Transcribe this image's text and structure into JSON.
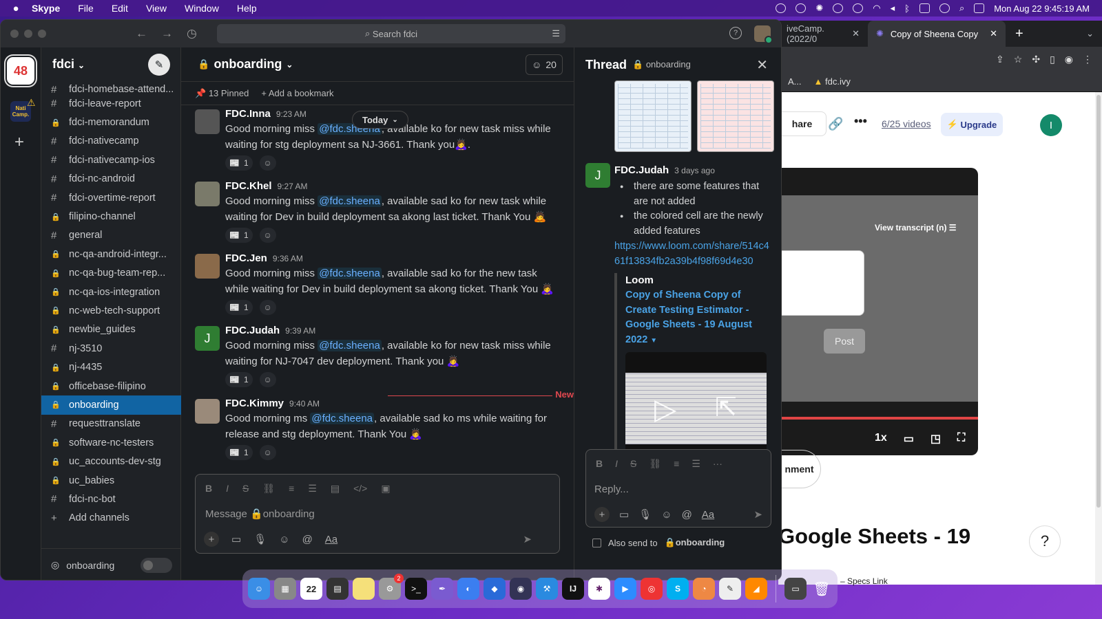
{
  "menubar": {
    "app_name": "Skype",
    "items": [
      "File",
      "Edit",
      "View",
      "Window",
      "Help"
    ],
    "datetime": "Mon Aug 22  9:45:19 AM"
  },
  "chrome": {
    "tabs": [
      {
        "label": "iveCamp. (2022/0",
        "active": false
      },
      {
        "label": "Copy of Sheena Copy",
        "active": true
      }
    ],
    "bookmarks": [
      "A...",
      "fdc.ivy"
    ],
    "page": {
      "share_label": "hare",
      "videos_label": "6/25 videos",
      "upgrade_label": "Upgrade",
      "avatar_initial": "I",
      "transcript_label": "View transcript (n)",
      "post_label": "Post",
      "speed_label": "1x",
      "comment_label": "nment",
      "heading": "Google Sheets - 19",
      "help_label": "?",
      "below_text": "– Specs Link"
    }
  },
  "slack": {
    "search_placeholder": "Search fdci",
    "workspace": {
      "name": "fdci",
      "logo_text": "48",
      "second_ws_text": "Nati Camp."
    },
    "channels": [
      {
        "sym": "#",
        "name": "fdci-homebase-attend..."
      },
      {
        "sym": "#",
        "name": "fdci-leave-report"
      },
      {
        "sym": "🔒",
        "name": "fdci-memorandum"
      },
      {
        "sym": "#",
        "name": "fdci-nativecamp"
      },
      {
        "sym": "#",
        "name": "fdci-nativecamp-ios"
      },
      {
        "sym": "#",
        "name": "fdci-nc-android"
      },
      {
        "sym": "#",
        "name": "fdci-overtime-report"
      },
      {
        "sym": "🔒",
        "name": "filipino-channel"
      },
      {
        "sym": "#",
        "name": "general"
      },
      {
        "sym": "🔒",
        "name": "nc-qa-android-integr..."
      },
      {
        "sym": "🔒",
        "name": "nc-qa-bug-team-rep..."
      },
      {
        "sym": "🔒",
        "name": "nc-qa-ios-integration"
      },
      {
        "sym": "🔒",
        "name": "nc-web-tech-support"
      },
      {
        "sym": "🔒",
        "name": "newbie_guides"
      },
      {
        "sym": "#",
        "name": "nj-3510"
      },
      {
        "sym": "🔒",
        "name": "nj-4435"
      },
      {
        "sym": "🔒",
        "name": "officebase-filipino"
      },
      {
        "sym": "🔒",
        "name": "onboarding",
        "active": true
      },
      {
        "sym": "#",
        "name": "requesttranslate"
      },
      {
        "sym": "🔒",
        "name": "software-nc-testers"
      },
      {
        "sym": "🔒",
        "name": "uc_accounts-dev-stg"
      },
      {
        "sym": "🔒",
        "name": "uc_babies"
      },
      {
        "sym": "#",
        "name": "fdci-nc-bot"
      },
      {
        "sym": "+",
        "name": "Add channels"
      }
    ],
    "huddle_label": "onboarding",
    "channel": {
      "name": "onboarding",
      "member_count": "20",
      "pinned_label": "13 Pinned",
      "bookmark_label": "Add a bookmark",
      "today_label": "Today",
      "new_label": "New",
      "composer_placeholder": "Message 🔒onboarding"
    },
    "messages": [
      {
        "name": "FDC.Inna",
        "time": "9:23 AM",
        "pre": "Good morning miss ",
        "mention": "@fdc.sheena",
        "post": ", available ko for new task miss while waiting for stg deployment sa NJ-3661. Thank you🙇‍♀️.",
        "react_count": "1"
      },
      {
        "name": "FDC.Khel",
        "time": "9:27 AM",
        "pre": "Good morning miss ",
        "mention": "@fdc.sheena",
        "post": ", available sad ko for new task while waiting for Dev in build deployment sa akong last ticket. Thank You 🙇",
        "react_count": "1"
      },
      {
        "name": "FDC.Jen",
        "time": "9:36 AM",
        "pre": "Good morning miss ",
        "mention": "@fdc.sheena",
        "post": ", available sad ko for the new task while waiting for Dev in build deployment sa akong ticket. Thank You 🙇‍♀️",
        "react_count": "1"
      },
      {
        "name": "FDC.Judah",
        "time": "9:39 AM",
        "pre": "Good morning miss ",
        "mention": "@fdc.sheena",
        "post": ", available ko for new task miss while waiting for NJ-7047 dev deployment. Thank you 🙇‍♀️",
        "react_count": "1",
        "initial": "J"
      },
      {
        "name": "FDC.Kimmy",
        "time": "9:40 AM",
        "pre": "Good morning ms ",
        "mention": "@fdc.sheena",
        "post": ", available sad ko ms while waiting for release and stg deployment. Thank You 🙇‍♀️",
        "react_count": "1"
      }
    ],
    "thread": {
      "title": "Thread",
      "channel": "onboarding",
      "author": "FDC.Judah",
      "author_initial": "J",
      "time": "3 days ago",
      "bullets": [
        "there are some features that are not added",
        "the colored cell are the newly added features"
      ],
      "link": "https://www.loom.com/share/514c461f13834fb2a39b4f98f69d4e30",
      "unfurl_source": "Loom",
      "unfurl_title": "Copy of Sheena Copy of Create Testing Estimator - Google Sheets - 19 August 2022",
      "reply_placeholder": "Reply...",
      "also_send_prefix": "Also send to",
      "also_send_channel": "onboarding"
    }
  }
}
